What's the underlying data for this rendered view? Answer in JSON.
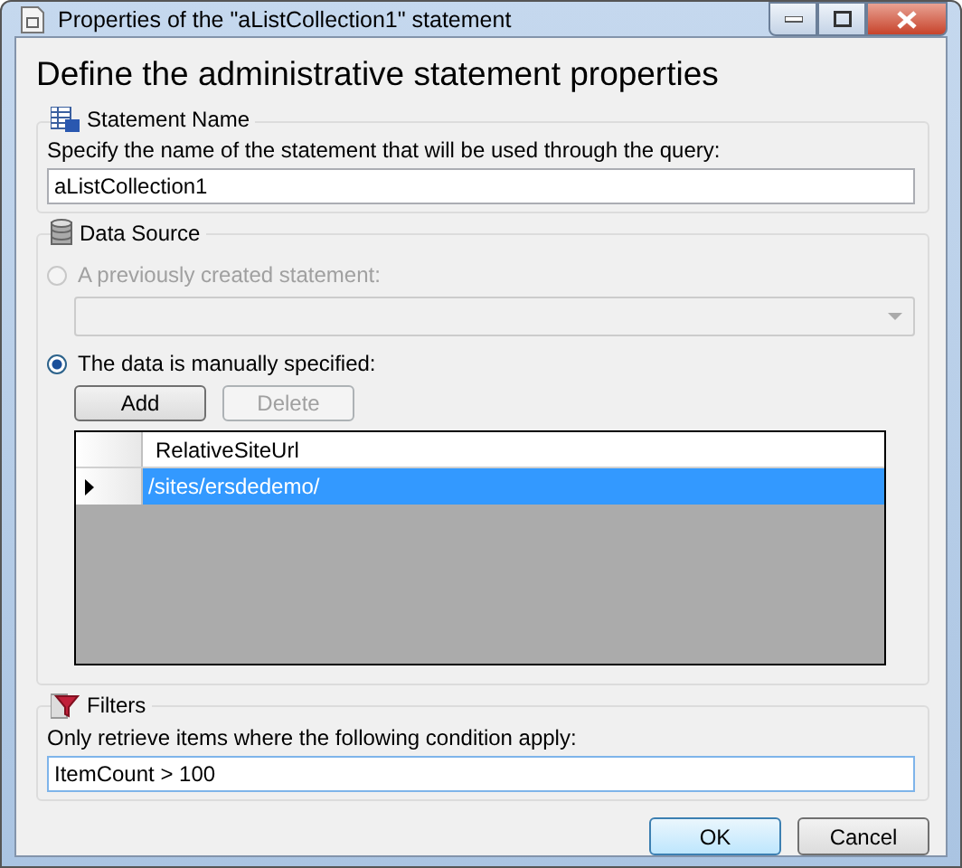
{
  "window": {
    "title": "Properties of the \"aListCollection1\" statement"
  },
  "heading": "Define the administrative statement properties",
  "statement_name": {
    "legend": "Statement Name",
    "label": "Specify the name of the statement that will be used through the query:",
    "value": "aListCollection1"
  },
  "data_source": {
    "legend": "Data Source",
    "options": [
      {
        "label": "A previously created statement:",
        "selected": false,
        "disabled": true
      },
      {
        "label": "The data is manually specified:",
        "selected": true,
        "disabled": false
      }
    ],
    "buttons": [
      {
        "label": "Add",
        "disabled": false
      },
      {
        "label": "Delete",
        "disabled": true
      }
    ],
    "grid": {
      "columns": [
        "RelativeSiteUrl"
      ],
      "rows": [
        {
          "cells": [
            "/sites/ersdedemo/"
          ],
          "selected": true
        }
      ]
    }
  },
  "filters": {
    "legend": "Filters",
    "label": "Only retrieve items where the following condition apply:",
    "value": "ItemCount > 100"
  },
  "buttons": [
    {
      "label": "OK",
      "default": true
    },
    {
      "label": "Cancel",
      "default": false
    }
  ]
}
